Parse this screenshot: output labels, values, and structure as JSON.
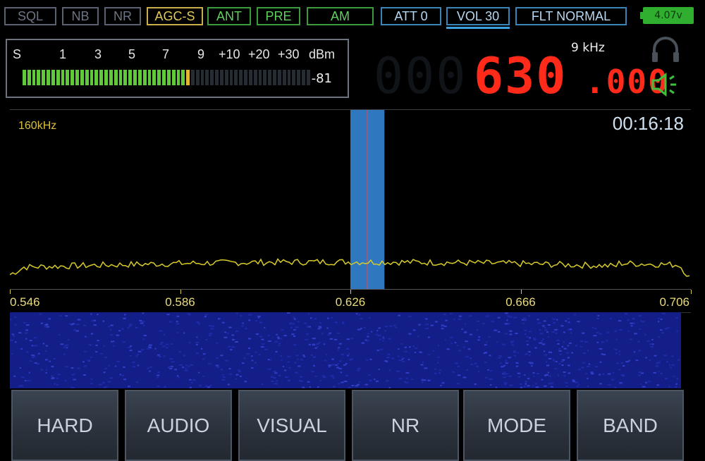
{
  "status_bar": {
    "items": [
      {
        "label": "SQL",
        "state": "off"
      },
      {
        "label": "NB",
        "state": "off"
      },
      {
        "label": "NR",
        "state": "off"
      },
      {
        "label": "AGC-S",
        "state": "yellow"
      },
      {
        "label": "ANT",
        "state": "green"
      },
      {
        "label": "PRE",
        "state": "green"
      },
      {
        "label": "AM",
        "state": "green"
      },
      {
        "label": "ATT 0",
        "state": "blue"
      },
      {
        "label": "VOL 30",
        "state": "blue"
      },
      {
        "label": "FLT NORMAL",
        "state": "blue"
      }
    ],
    "battery": "4.07v"
  },
  "meter": {
    "scale": [
      "S",
      "1",
      "3",
      "5",
      "7",
      "9",
      "+10",
      "+20",
      "+30",
      "dBm"
    ],
    "value": "-81",
    "level_fraction": 0.58,
    "segments": 60
  },
  "frequency": {
    "main": "630",
    "decimal": ".000",
    "ghost": "000",
    "step": "9 kHz"
  },
  "spectrum": {
    "span": "160kHz",
    "clock": "00:16:18",
    "axis_labels": [
      "0.546",
      "0.586",
      "0.626",
      "0.666",
      "0.706"
    ],
    "axis_min": 0.546,
    "axis_max": 0.706,
    "tuned": 0.63,
    "filter_low": 0.626,
    "filter_high": 0.634
  },
  "buttons": [
    "HARD",
    "AUDIO",
    "VISUAL",
    "NR",
    "MODE",
    "BAND"
  ],
  "colors": {
    "frequency": "#ff2a1a",
    "trace": "#d8cc28",
    "filter": "#2f78c0",
    "waterfall": "#141e88"
  }
}
